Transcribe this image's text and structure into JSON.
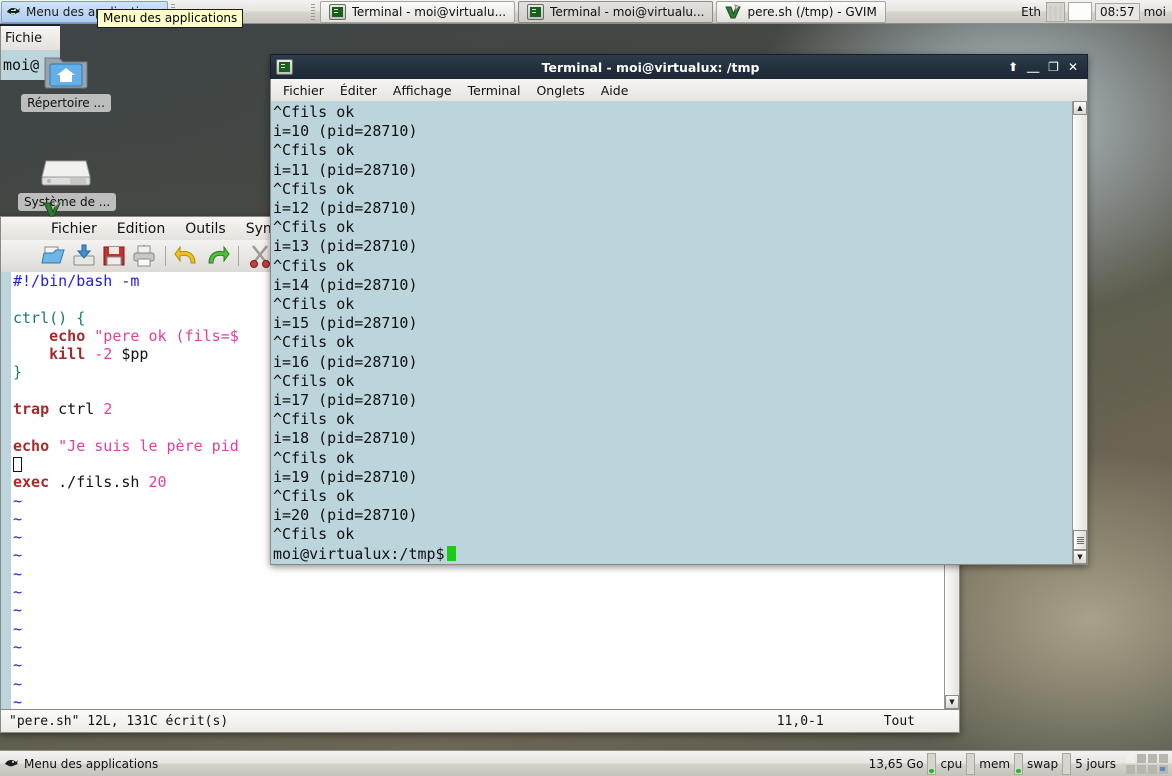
{
  "top_panel": {
    "app_menu_label": "Menu des applications",
    "app_menu_icon": "mouse-icon",
    "tooltip_text": "Menu des applications",
    "tasks": [
      {
        "label": "Terminal - moi@virtualu...",
        "icon": "terminal-icon",
        "active": false
      },
      {
        "label": "Terminal - moi@virtualu...",
        "icon": "terminal-icon",
        "active": true
      },
      {
        "label": "pere.sh (/tmp) - GVIM",
        "icon": "gvim-icon",
        "active": false
      }
    ],
    "tray": {
      "netload_label": "Eth",
      "clock": "08:57",
      "user": "moi"
    }
  },
  "desktop": {
    "icons": [
      {
        "label": "Répertoire ...",
        "icon": "home-folder-icon"
      },
      {
        "label": "Système de ...",
        "icon": "harddisk-icon"
      }
    ]
  },
  "back_window": {
    "menu_label": "Fichie",
    "terminal_text": "moi@"
  },
  "terminal": {
    "title": "Terminal - moi@virtualux: /tmp",
    "icon": "terminal-icon",
    "window_buttons": [
      "shade",
      "minimize",
      "maximize",
      "close"
    ],
    "menus": [
      "Fichier",
      "Éditer",
      "Affichage",
      "Terminal",
      "Onglets",
      "Aide"
    ],
    "background_color": "#bcd4dc",
    "lines": [
      "^Cfils ok",
      "i=10 (pid=28710)",
      "^Cfils ok",
      "i=11 (pid=28710)",
      "^Cfils ok",
      "i=12 (pid=28710)",
      "^Cfils ok",
      "i=13 (pid=28710)",
      "^Cfils ok",
      "i=14 (pid=28710)",
      "^Cfils ok",
      "i=15 (pid=28710)",
      "^Cfils ok",
      "i=16 (pid=28710)",
      "^Cfils ok",
      "i=17 (pid=28710)",
      "^Cfils ok",
      "i=18 (pid=28710)",
      "^Cfils ok",
      "i=19 (pid=28710)",
      "^Cfils ok",
      "i=20 (pid=28710)",
      "^Cfils ok"
    ],
    "prompt": "moi@virtualux:/tmp$",
    "cursor_color": "#18cd18"
  },
  "gvim": {
    "icon": "gvim-icon",
    "menus": [
      "Fichier",
      "Edition",
      "Outils",
      "Syntaxe"
    ],
    "toolbar_icons": [
      "open-file-icon",
      "save-as-icon",
      "save-icon",
      "print-icon",
      "separator",
      "undo-icon",
      "redo-icon",
      "separator",
      "cut-icon"
    ],
    "code_lines": [
      {
        "segments": [
          {
            "t": "#!/bin/bash -m",
            "c": "v-comment"
          }
        ]
      },
      {
        "segments": [
          {
            "t": "",
            "c": ""
          }
        ]
      },
      {
        "segments": [
          {
            "t": "ctrl() {",
            "c": "v-func"
          }
        ]
      },
      {
        "segments": [
          {
            "t": "    ",
            "c": ""
          },
          {
            "t": "echo",
            "c": "v-kw"
          },
          {
            "t": " ",
            "c": ""
          },
          {
            "t": "\"pere ok (fils=$",
            "c": "v-str"
          }
        ]
      },
      {
        "segments": [
          {
            "t": "    ",
            "c": ""
          },
          {
            "t": "kill",
            "c": "v-kw"
          },
          {
            "t": " ",
            "c": ""
          },
          {
            "t": "-2",
            "c": "v-num"
          },
          {
            "t": " $pp",
            "c": ""
          }
        ]
      },
      {
        "segments": [
          {
            "t": "}",
            "c": "v-func"
          }
        ]
      },
      {
        "segments": [
          {
            "t": "",
            "c": ""
          }
        ]
      },
      {
        "segments": [
          {
            "t": "trap",
            "c": "v-kw"
          },
          {
            "t": " ctrl ",
            "c": ""
          },
          {
            "t": "2",
            "c": "v-num"
          }
        ]
      },
      {
        "segments": [
          {
            "t": "",
            "c": ""
          }
        ]
      },
      {
        "segments": [
          {
            "t": "echo",
            "c": "v-kw"
          },
          {
            "t": " ",
            "c": ""
          },
          {
            "t": "\"Je suis le père pid",
            "c": "v-str"
          }
        ]
      },
      {
        "segments": [
          {
            "t": "CURSOR",
            "c": "cursor"
          }
        ]
      },
      {
        "segments": [
          {
            "t": "exec",
            "c": "v-kw"
          },
          {
            "t": " ./fils.sh ",
            "c": ""
          },
          {
            "t": "20",
            "c": "v-num"
          }
        ]
      }
    ],
    "empty_line_marker": "~",
    "empty_line_count": 12,
    "status_file": "\"pere.sh\" 12L, 131C écrit(s)",
    "status_position": "11,0-1",
    "status_view": "Tout"
  },
  "bottom_panel": {
    "app_menu_label": "Menu des applications",
    "disk_free": "13,65 Go",
    "cpu_label": "cpu",
    "mem_label": "mem",
    "swap_label": "swap",
    "uptime": "5 jours"
  }
}
